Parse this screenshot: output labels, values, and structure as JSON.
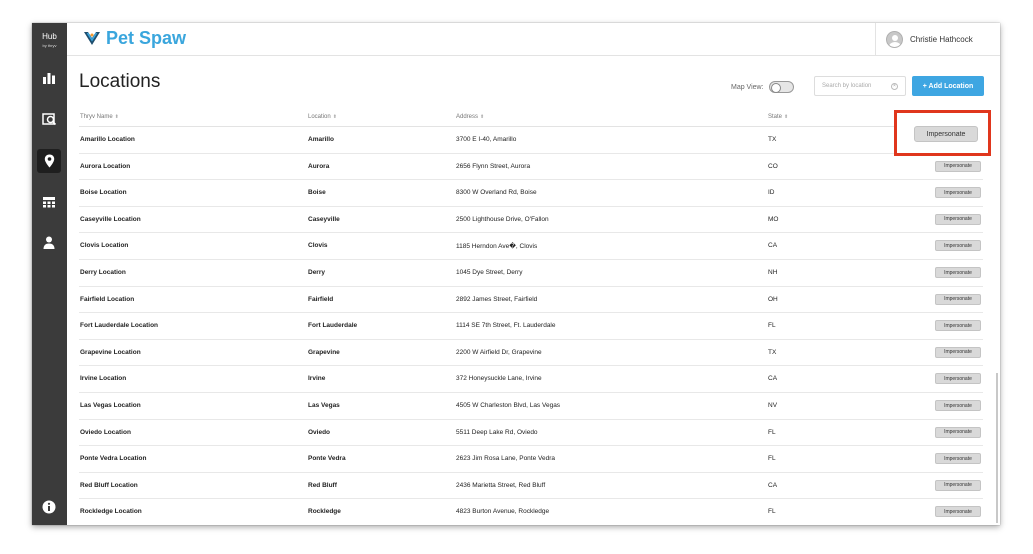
{
  "sidebar": {
    "hub_label": "Hub",
    "hub_sub": "by thryv",
    "icons": [
      "bar-chart-icon",
      "analytics-icon",
      "location-pin-icon",
      "grid-icon",
      "user-icon",
      "info-icon"
    ]
  },
  "header": {
    "brand": "Pet Spaw",
    "user_name": "Christie Hathcock"
  },
  "page": {
    "title": "Locations",
    "map_view_label": "Map View:",
    "search_placeholder": "Search by location",
    "add_button": "+ Add Location"
  },
  "table": {
    "columns": [
      "Thryv Name",
      "Location",
      "Address",
      "State"
    ],
    "impersonate_label": "Impersonate",
    "rows": [
      {
        "name": "Amarillo Location",
        "location": "Amarillo",
        "address": "3700 E I-40, Amarillo",
        "state": "TX"
      },
      {
        "name": "Aurora Location",
        "location": "Aurora",
        "address": "2656 Flynn Street, Aurora",
        "state": "CO"
      },
      {
        "name": "Boise Location",
        "location": "Boise",
        "address": "8300 W Overland Rd, Boise",
        "state": "ID"
      },
      {
        "name": "Caseyville Location",
        "location": "Caseyville",
        "address": "2500 Lighthouse Drive, O'Fallon",
        "state": "MO"
      },
      {
        "name": "Clovis Location",
        "location": "Clovis",
        "address": "1185 Herndon Ave�, Clovis",
        "state": "CA"
      },
      {
        "name": "Derry Location",
        "location": "Derry",
        "address": "1045 Dye Street, Derry",
        "state": "NH"
      },
      {
        "name": "Fairfield Location",
        "location": "Fairfield",
        "address": "2892 James Street, Fairfield",
        "state": "OH"
      },
      {
        "name": "Fort Lauderdale Location",
        "location": "Fort Lauderdale",
        "address": "1114 SE 7th Street, Ft. Lauderdale",
        "state": "FL"
      },
      {
        "name": "Grapevine Location",
        "location": "Grapevine",
        "address": "2200 W Airfield Dr, Grapevine",
        "state": "TX"
      },
      {
        "name": "Irvine Location",
        "location": "Irvine",
        "address": "372 Honeysuckle Lane, Irvine",
        "state": "CA"
      },
      {
        "name": "Las Vegas Location",
        "location": "Las Vegas",
        "address": "4505 W Charleston Blvd, Las Vegas",
        "state": "NV"
      },
      {
        "name": "Oviedo Location",
        "location": "Oviedo",
        "address": "5511 Deep Lake Rd, Oviedo",
        "state": "FL"
      },
      {
        "name": "Ponte Vedra Location",
        "location": "Ponte Vedra",
        "address": "2623 Jim Rosa Lane, Ponte Vedra",
        "state": "FL"
      },
      {
        "name": "Red Bluff Location",
        "location": "Red Bluff",
        "address": "2436 Marietta Street, Red Bluff",
        "state": "CA"
      },
      {
        "name": "Rockledge Location",
        "location": "Rockledge",
        "address": "4823 Burton Avenue, Rockledge",
        "state": "FL"
      }
    ]
  },
  "colors": {
    "sidebar": "#3b3b3b",
    "brand": "#3aa6dd",
    "primary_button": "#3ea6e2",
    "highlight_box": "#e0361d"
  }
}
